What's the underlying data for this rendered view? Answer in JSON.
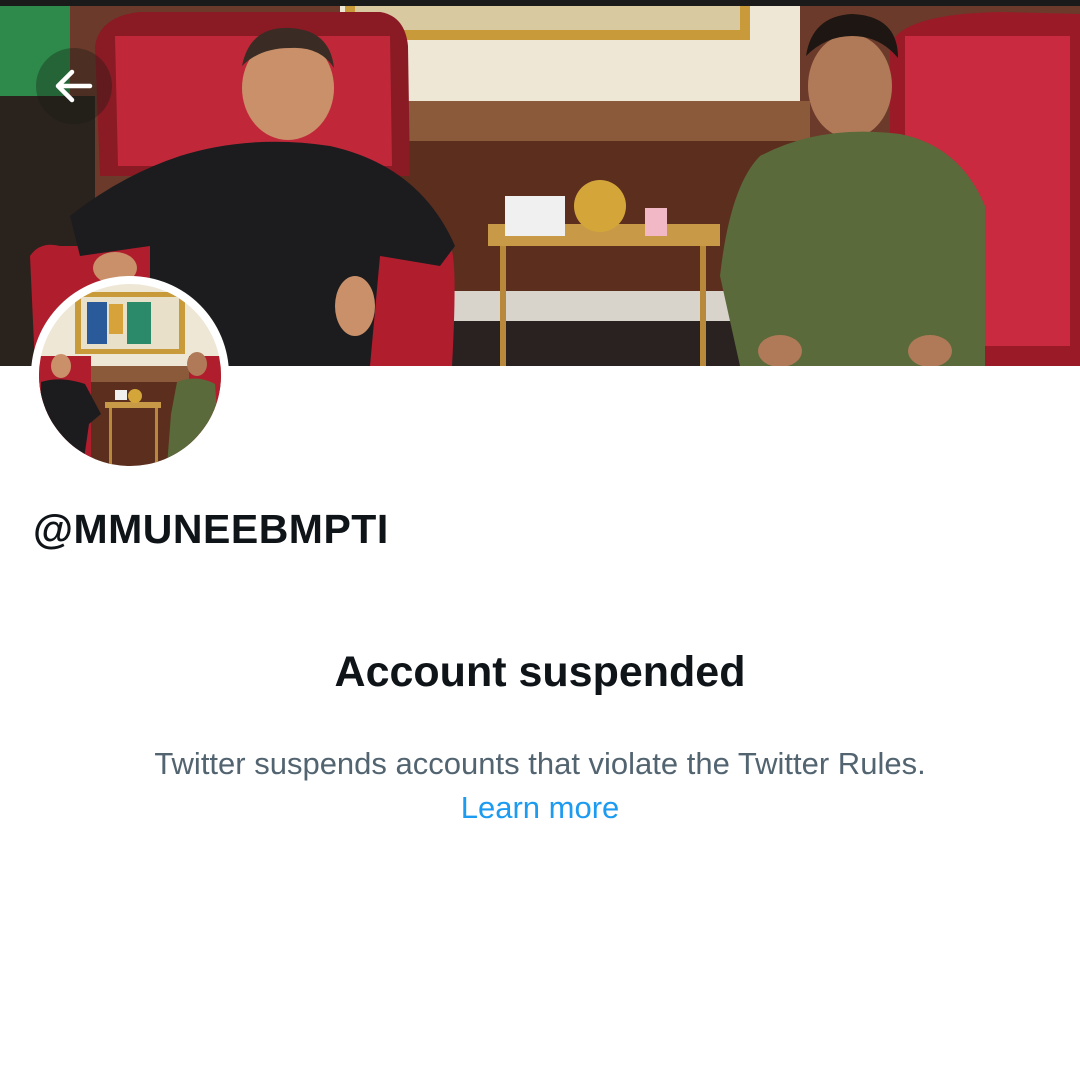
{
  "header": {
    "back_icon": "arrow-left-icon"
  },
  "profile": {
    "handle": "@MMUNEEBMPTI"
  },
  "suspension": {
    "title": "Account suspended",
    "description": "Twitter suspends accounts that violate the Twitter Rules.",
    "link_label": "Learn more"
  },
  "colors": {
    "title": "#0f1419",
    "description": "#536471",
    "link": "#1d9bf0",
    "background": "#ffffff"
  }
}
